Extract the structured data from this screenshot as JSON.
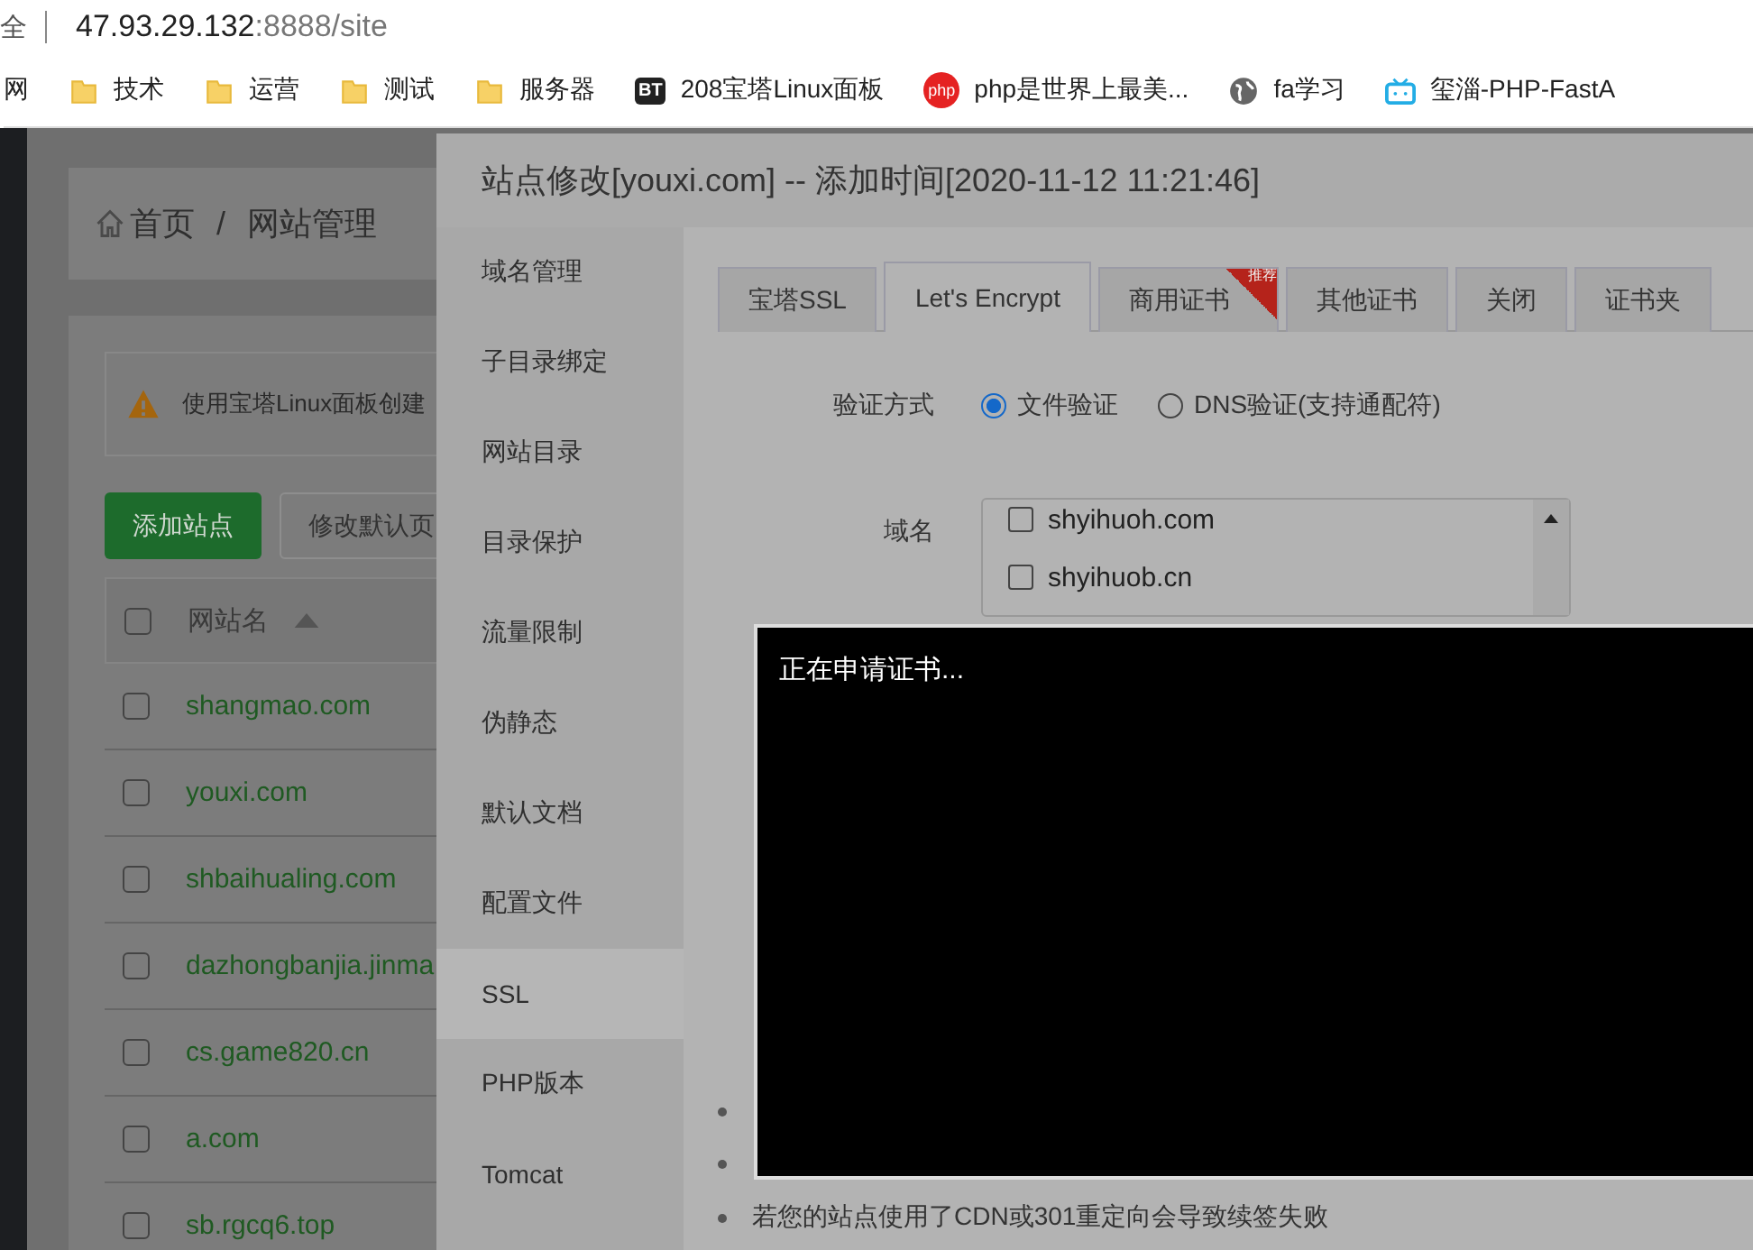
{
  "address_bar": {
    "left_fragment": "全",
    "host": "47.93.29.132",
    "path": ":8888/site"
  },
  "bookmarks": [
    {
      "kind": "cut",
      "label": "网"
    },
    {
      "kind": "folder",
      "label": "技术"
    },
    {
      "kind": "folder",
      "label": "运营"
    },
    {
      "kind": "folder",
      "label": "测试"
    },
    {
      "kind": "folder",
      "label": "服务器"
    },
    {
      "kind": "badge",
      "icon_text": "BT",
      "label": "208宝塔Linux面板"
    },
    {
      "kind": "round",
      "icon_text": "php",
      "label": "php是世界上最美..."
    },
    {
      "kind": "globe",
      "label": "fa学习"
    },
    {
      "kind": "tv",
      "label": "玺淄-PHP-FastA"
    }
  ],
  "page": {
    "breadcrumb": [
      "首页",
      "/",
      "网站管理"
    ],
    "notice": "使用宝塔Linux面板创建",
    "buttons": [
      {
        "label": "添加站点",
        "kind": "primary"
      },
      {
        "label": "修改默认页",
        "kind": "plain"
      }
    ],
    "table": {
      "header": "网站名",
      "header_checked": false,
      "rows": [
        {
          "name": "shangmao.com",
          "checked": false
        },
        {
          "name": "youxi.com",
          "checked": false
        },
        {
          "name": "shbaihualing.com",
          "checked": false
        },
        {
          "name": "dazhongbanjia.jinma",
          "checked": false
        },
        {
          "name": "cs.game820.cn",
          "checked": false
        },
        {
          "name": "a.com",
          "checked": false
        },
        {
          "name": "sb.rgcq6.top",
          "checked": false
        }
      ]
    }
  },
  "modal": {
    "title": "站点修改[youxi.com] -- 添加时间[2020-11-12 11:21:46]",
    "sidebar": [
      {
        "label": "域名管理",
        "selected": false
      },
      {
        "label": "子目录绑定",
        "selected": false
      },
      {
        "label": "网站目录",
        "selected": false
      },
      {
        "label": "目录保护",
        "selected": false
      },
      {
        "label": "流量限制",
        "selected": false
      },
      {
        "label": "伪静态",
        "selected": false
      },
      {
        "label": "默认文档",
        "selected": false
      },
      {
        "label": "配置文件",
        "selected": false
      },
      {
        "label": "SSL",
        "selected": true
      },
      {
        "label": "PHP版本",
        "selected": false
      },
      {
        "label": "Tomcat",
        "selected": false
      }
    ],
    "tabs": [
      {
        "label": "宝塔SSL",
        "selected": false
      },
      {
        "label": "Let's Encrypt",
        "selected": true
      },
      {
        "label": "商用证书",
        "selected": false,
        "ribbon": "推荐"
      },
      {
        "label": "其他证书",
        "selected": false
      },
      {
        "label": "关闭",
        "selected": false
      },
      {
        "label": "证书夹",
        "selected": false
      }
    ],
    "verify": {
      "label": "验证方式",
      "options": [
        {
          "label": "文件验证",
          "selected": true
        },
        {
          "label": "DNS验证(支持通配符)",
          "selected": false
        }
      ]
    },
    "domains": {
      "label": "域名",
      "items": [
        {
          "name": "shyihuoh.com",
          "checked": false
        },
        {
          "name": "shyihuob.cn",
          "checked": false
        }
      ]
    },
    "notes": [
      "若您的站点使用了CDN或301重定向会导致续签失败"
    ]
  },
  "terminal": {
    "text": "正在申请证书..."
  }
}
